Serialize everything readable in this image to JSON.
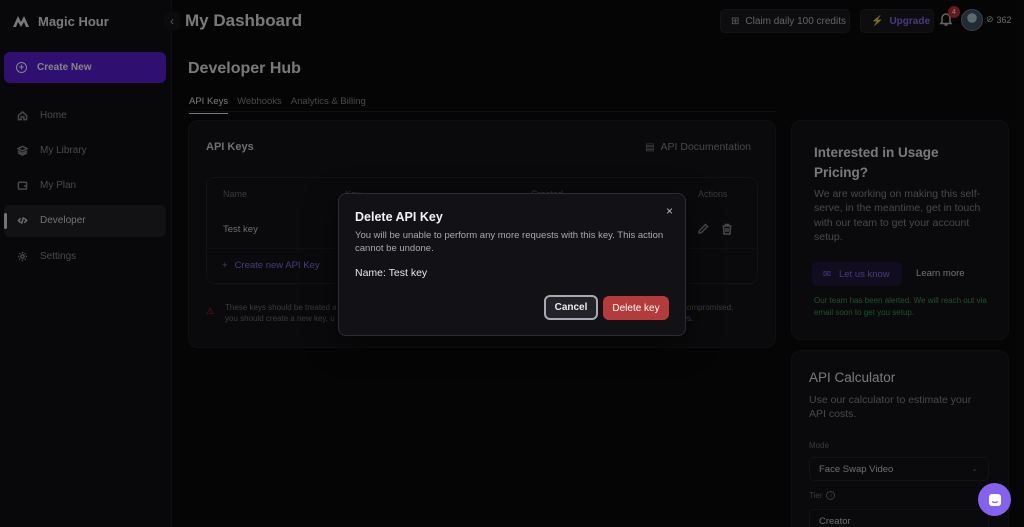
{
  "brand": {
    "name": "Magic Hour"
  },
  "sidebar": {
    "create_label": "Create New",
    "items": [
      {
        "label": "Home",
        "icon": "home-icon"
      },
      {
        "label": "My Library",
        "icon": "layers-icon"
      },
      {
        "label": "My Plan",
        "icon": "wallet-icon"
      },
      {
        "label": "Developer",
        "icon": "code-icon"
      },
      {
        "label": "Settings",
        "icon": "gear-icon"
      }
    ],
    "active_item": "Developer"
  },
  "header": {
    "title": "My Dashboard",
    "claim_label": "Claim daily 100 credits",
    "upgrade_label": "Upgrade",
    "notification_count": "4",
    "credits": "362"
  },
  "main": {
    "title": "Developer Hub",
    "tabs": [
      {
        "label": "API Keys"
      },
      {
        "label": "Webhooks"
      },
      {
        "label": "Analytics & Billing"
      }
    ],
    "active_tab": "API Keys",
    "api_keys": {
      "title": "API Keys",
      "doc_link": "API Documentation",
      "columns": {
        "name": "Name",
        "key": "Key",
        "created": "Created",
        "actions": "Actions"
      },
      "rows": [
        {
          "name": "Test key"
        }
      ],
      "create_link": "Create new API Key",
      "warning_left": "These keys should be treated a",
      "warning_left2": "you should create a new key, u",
      "warning_right": "compromised,",
      "warning_right2": "ys."
    }
  },
  "pricing": {
    "title": "Interested in Usage Pricing?",
    "description": "We are working on making this self-serve, in the meantime, get in touch with our team to get your account setup.",
    "contact_label": "Let us know",
    "learn_more": "Learn more",
    "alert": "Our team has been alerted. We will reach out via email soon to get you setup."
  },
  "calculator": {
    "title": "API Calculator",
    "description": "Use our calculator to estimate your API costs.",
    "mode_label": "Mode",
    "mode_value": "Face Swap Video",
    "tier_label": "Tier",
    "tier_value": "Creator"
  },
  "modal": {
    "title": "Delete API Key",
    "description": "You will be unable to perform any more requests with this key. This action cannot be undone.",
    "name_line": "Name: Test key",
    "close": "×",
    "cancel_label": "Cancel",
    "delete_label": "Delete key"
  },
  "colors": {
    "accent": "#5a1ed6",
    "danger": "#b53a3a",
    "link": "#8c6cf0",
    "success": "#2f9e5a"
  }
}
